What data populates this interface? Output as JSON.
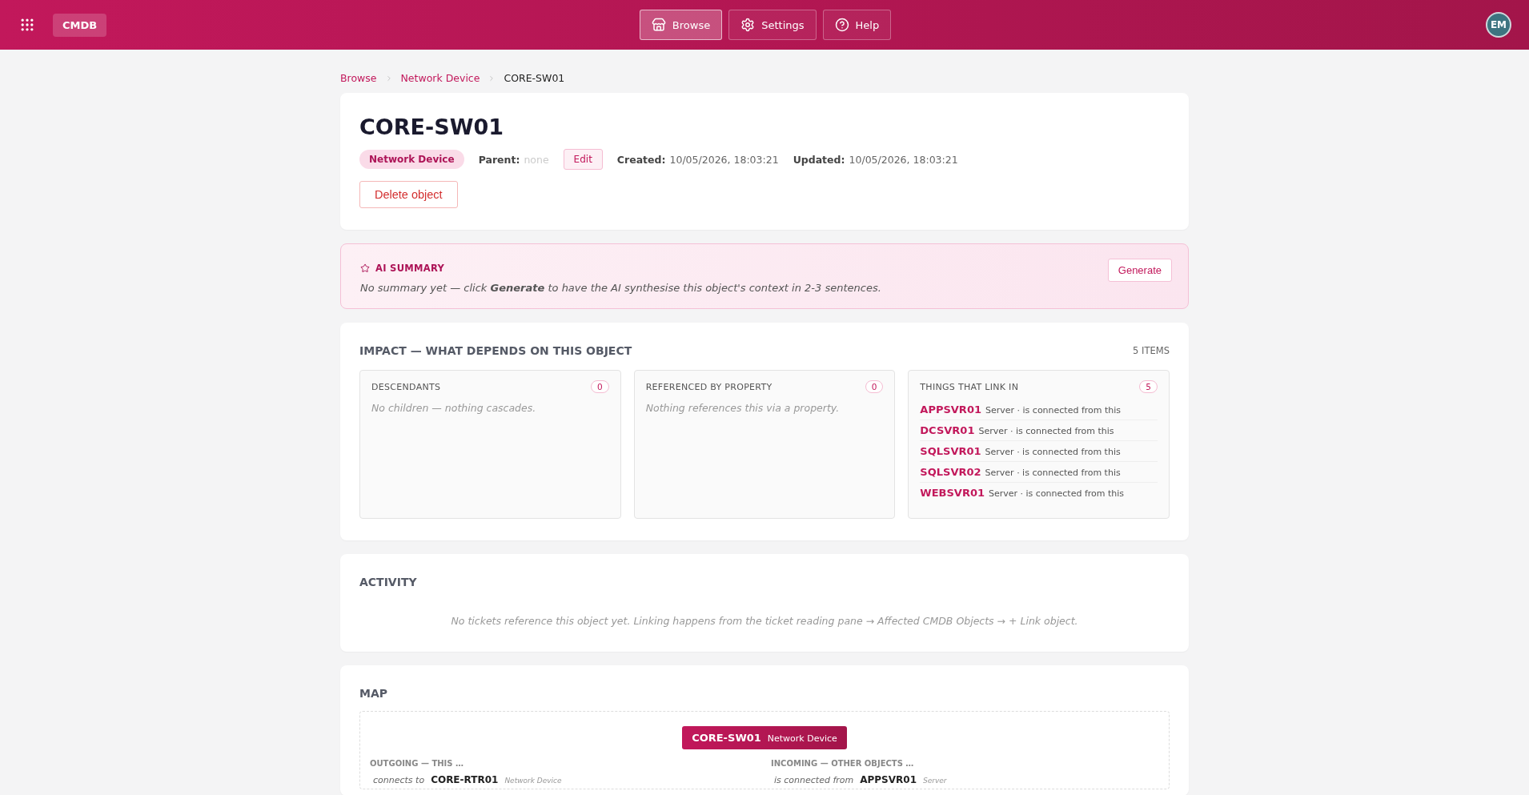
{
  "header": {
    "app_name": "CMDB",
    "nav": [
      {
        "label": "Browse",
        "selected": true
      },
      {
        "label": "Settings",
        "selected": false
      },
      {
        "label": "Help",
        "selected": false
      }
    ],
    "avatar": "EM"
  },
  "breadcrumb": [
    "Browse",
    "Network Device",
    "CORE-SW01"
  ],
  "object": {
    "title": "CORE-SW01",
    "type": "Network Device",
    "parent_label": "Parent:",
    "parent_value": "none",
    "edit": "Edit",
    "created_label": "Created:",
    "created": "10/05/2026, 18:03:21",
    "updated_label": "Updated:",
    "updated": "10/05/2026, 18:03:21",
    "delete": "Delete object"
  },
  "ai_summary": {
    "title": "AI SUMMARY",
    "button": "Generate",
    "text": "No summary yet — click **Generate** to have the AI synthesise this object's context in 2-3 sentences."
  },
  "impact": {
    "title": "IMPACT — WHAT DEPENDS ON THIS OBJECT",
    "count": "5 ITEMS",
    "panels": [
      {
        "title": "DESCENDANTS",
        "count": "0",
        "empty": "No children — nothing cascades."
      },
      {
        "title": "REFERENCED BY PROPERTY",
        "count": "0",
        "empty": "Nothing references this via a property."
      },
      {
        "title": "THINGS THAT LINK IN",
        "count": "5",
        "items": [
          {
            "name": "APPSVR01",
            "detail": "Server · is connected from this"
          },
          {
            "name": "DCSVR01",
            "detail": "Server · is connected from this"
          },
          {
            "name": "SQLSVR01",
            "detail": "Server · is connected from this"
          },
          {
            "name": "SQLSVR02",
            "detail": "Server · is connected from this"
          },
          {
            "name": "WEBSVR01",
            "detail": "Server · is connected from this"
          }
        ]
      }
    ]
  },
  "activity": {
    "title": "ACTIVITY",
    "empty": "No tickets reference this object yet. Linking happens from the ticket reading pane → Affected CMDB Objects → + Link object."
  },
  "map": {
    "title": "MAP",
    "center": {
      "name": "CORE-SW01",
      "type": "Network Device"
    },
    "groups": [
      {
        "title": "OUTGOING — THIS …",
        "items": [
          {
            "relation": "connects to",
            "name": "CORE-RTR01",
            "type": "Network Device"
          }
        ]
      },
      {
        "title": "INCOMING — OTHER OBJECTS …",
        "items": [
          {
            "relation": "is connected from",
            "name": "APPSVR01",
            "type": "Server"
          }
        ]
      }
    ]
  }
}
